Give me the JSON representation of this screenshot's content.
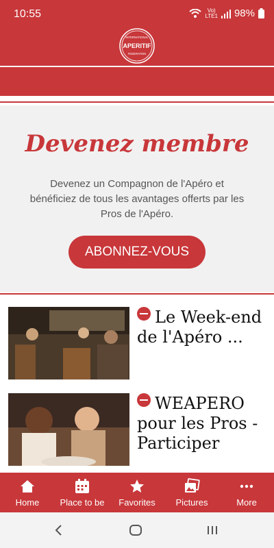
{
  "status": {
    "time": "10:55",
    "net_top": "Vo)",
    "net_bottom": "LTE1",
    "battery": "98%"
  },
  "logo": {
    "top": "INTERNATIONAL",
    "main": "APERITIF",
    "bottom": "FEDERATION"
  },
  "member": {
    "title": "Devenez membre",
    "text": "Devenez un Compagnon de l'Apéro et bénéficiez de tous les avantages offerts par les Pros de l'Apéro.",
    "cta": "ABONNEZ-VOUS"
  },
  "cards": [
    {
      "title": "Le Week-end de l'Apéro ..."
    },
    {
      "title": "WEAPERO pour les Pros - Participer"
    }
  ],
  "tabs": [
    {
      "label": "Home",
      "icon": "home-icon"
    },
    {
      "label": "Place to be",
      "icon": "calendar-icon"
    },
    {
      "label": "Favorites",
      "icon": "star-icon"
    },
    {
      "label": "Pictures",
      "icon": "pictures-icon"
    },
    {
      "label": "More",
      "icon": "more-icon"
    }
  ],
  "colors": {
    "brand": "#c8373a",
    "background": "#f1f1f1"
  }
}
